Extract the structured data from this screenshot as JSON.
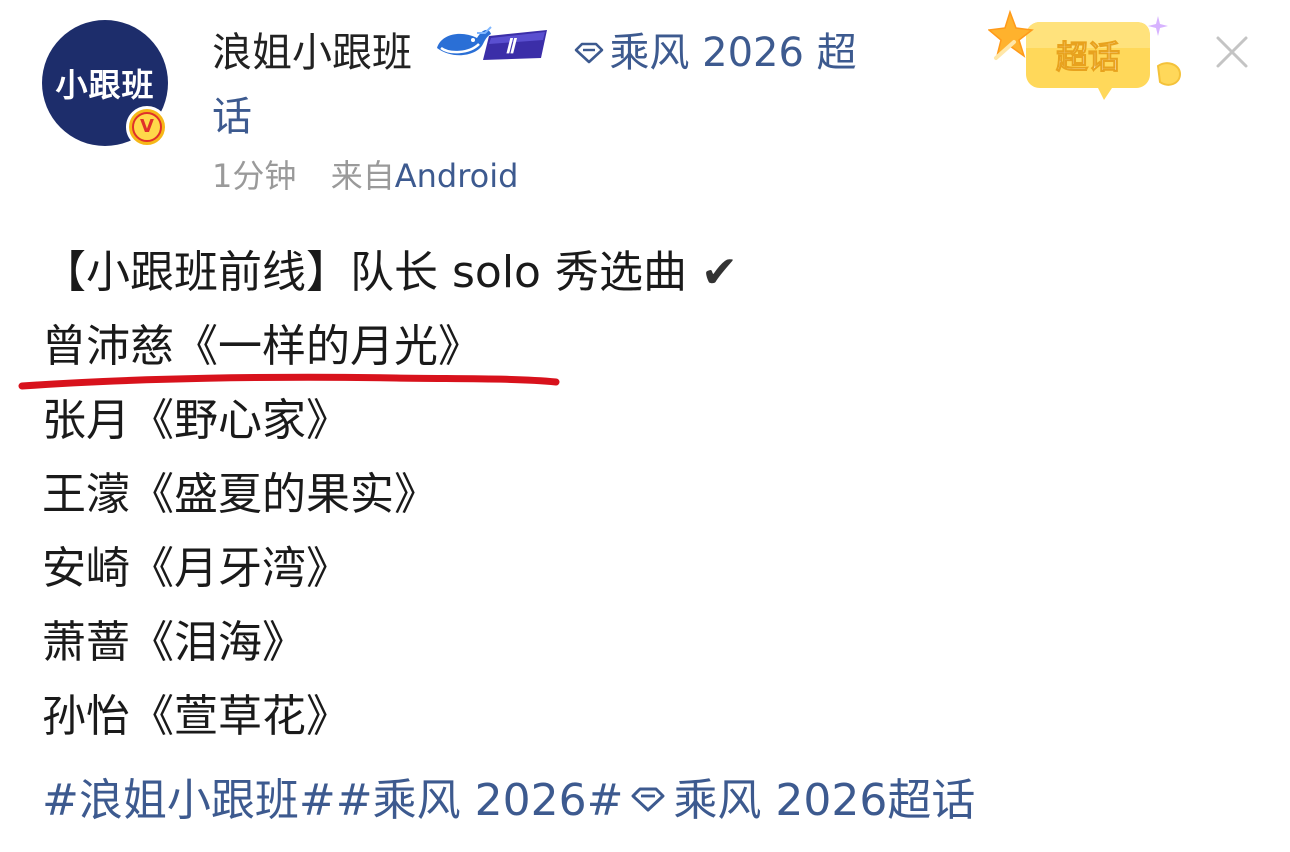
{
  "user": {
    "avatar_text": "小跟班",
    "verified_mark": "V",
    "name": "浪姐小跟班",
    "level_badge": "Ⅱ"
  },
  "topic": {
    "name_line1": "乘风 2026 超",
    "name_line2": "话",
    "badge_label": "超话"
  },
  "meta": {
    "time": "1分钟",
    "source_prefix": "来自",
    "source": "Android"
  },
  "post": {
    "intro": "【小跟班前线】队长 solo 秀选曲",
    "check_mark": "✔",
    "songs": [
      "曾沛慈《一样的月光》",
      "张月《野心家》",
      "王濛《盛夏的果实》",
      "安崎《月牙湾》",
      "萧蔷《泪海》",
      "孙怡《萱草花》"
    ],
    "hashtags_part1": "#浪姐小跟班##乘风 2026#",
    "hashtags_part2": "乘风 2026超话"
  },
  "colors": {
    "link": "#3d5a8f",
    "avatar_bg": "#1d2d6b",
    "underline": "#d8121c",
    "meta_gray": "#9a9a9a"
  }
}
